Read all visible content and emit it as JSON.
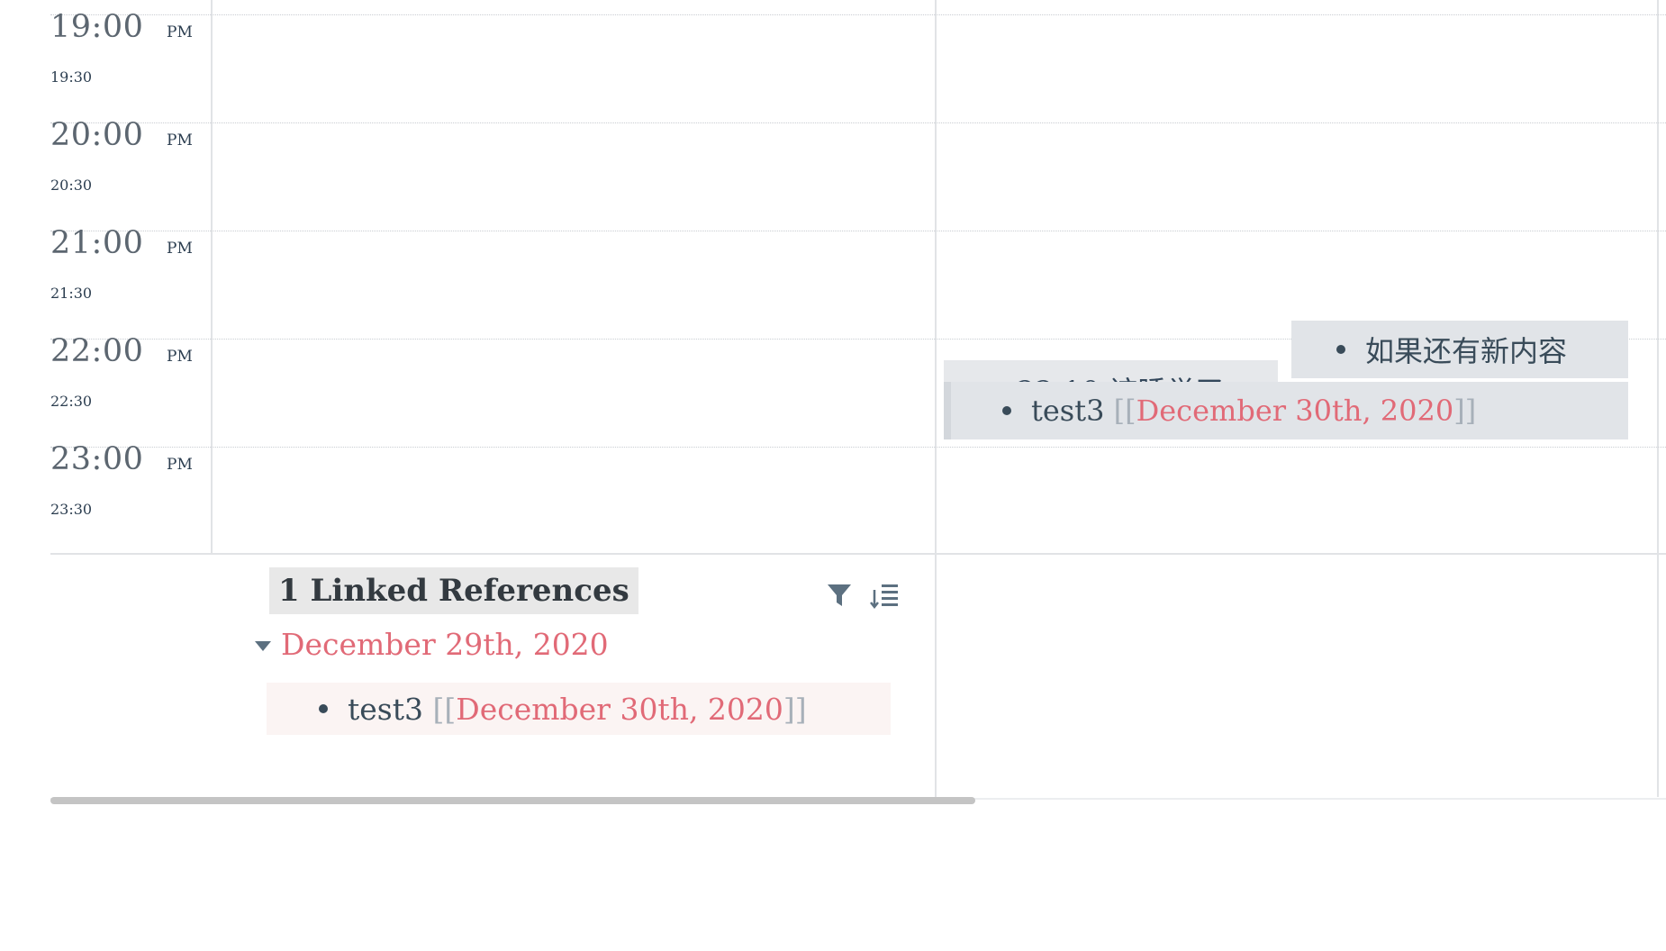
{
  "time_grid": [
    {
      "hour": "19:00",
      "ampm": "PM",
      "half": "19:30"
    },
    {
      "hour": "20:00",
      "ampm": "PM",
      "half": "20:30"
    },
    {
      "hour": "21:00",
      "ampm": "PM",
      "half": "21:30"
    },
    {
      "hour": "22:00",
      "ampm": "PM",
      "half": "22:30"
    },
    {
      "hour": "23:00",
      "ampm": "PM",
      "half": "23:30"
    }
  ],
  "events": {
    "hidden_partial_text": "• 22:10 该睡觉了",
    "chinese_block": "如果还有新内容",
    "test_block": {
      "text": "test3",
      "open": "[[",
      "ref": "December 30th, 2020",
      "close": "]]"
    }
  },
  "linked_refs": {
    "title": "1 Linked References",
    "filter_icon": "filter-icon",
    "sort_icon": "sort-icon",
    "page": "December 29th, 2020",
    "block": {
      "text": "test3",
      "open": "[[",
      "ref": "December 30th, 2020",
      "close": "]]"
    }
  },
  "colors": {
    "page_ref": "#e16a77",
    "event_bg": "#e1e4e8",
    "ref_block_bg": "#fbf4f3"
  }
}
